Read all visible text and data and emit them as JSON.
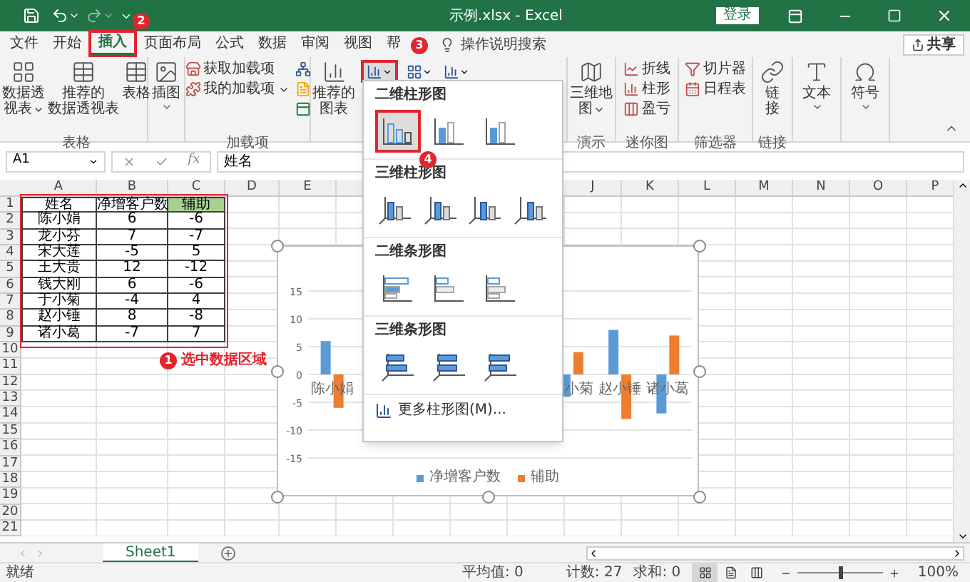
{
  "window": {
    "title": "示例.xlsx - Excel",
    "sign_in": "登录"
  },
  "tabs": [
    {
      "label": "文件",
      "selected": false,
      "highlighted": false
    },
    {
      "label": "开始",
      "selected": false,
      "highlighted": false
    },
    {
      "label": "插入",
      "selected": true,
      "highlighted": true
    },
    {
      "label": "页面布局",
      "selected": false,
      "highlighted": false
    },
    {
      "label": "公式",
      "selected": false,
      "highlighted": false
    },
    {
      "label": "数据",
      "selected": false,
      "highlighted": false
    },
    {
      "label": "审阅",
      "selected": false,
      "highlighted": false
    },
    {
      "label": "视图",
      "selected": false,
      "highlighted": false
    },
    {
      "label": "帮",
      "selected": false,
      "highlighted": false
    }
  ],
  "search": {
    "label": "操作说明搜索"
  },
  "share": {
    "label": "共享"
  },
  "ribbon": [
    {
      "name": "表格",
      "items": [
        {
          "kind": "large",
          "lines": [
            "数据透",
            "视表"
          ],
          "caret": true
        },
        {
          "kind": "large",
          "lines": [
            "推荐的",
            "数据透视表"
          ],
          "caret": false
        },
        {
          "kind": "large",
          "lines": [
            "表格"
          ],
          "caret": false
        }
      ]
    },
    {
      "items": [
        {
          "kind": "large",
          "lines": [
            "插图"
          ],
          "caret": true
        }
      ]
    },
    {
      "name": "加载项",
      "items": [
        {
          "kind": "small",
          "label": "获取加载项",
          "caret": false
        },
        {
          "kind": "small",
          "label": "我的加载项",
          "caret": true
        },
        {
          "kind": "icons"
        }
      ]
    },
    {
      "items": [
        {
          "kind": "large",
          "lines": [
            "推荐的",
            "图表"
          ],
          "caret": false
        },
        {
          "kind": "charts",
          "buttons": [
            {
              "highlighted": true
            },
            {
              "highlighted": false
            },
            {
              "highlighted": false
            }
          ]
        }
      ]
    },
    {
      "name": "演示",
      "items": [
        {
          "kind": "large",
          "lines": [
            "三维地",
            "图"
          ],
          "caret": true
        }
      ]
    },
    {
      "name": "迷你图",
      "items": [
        {
          "kind": "small",
          "label": "折线",
          "caret": false
        },
        {
          "kind": "small",
          "label": "柱形",
          "caret": false
        },
        {
          "kind": "small",
          "label": "盈亏",
          "caret": false
        }
      ]
    },
    {
      "name": "筛选器",
      "items": [
        {
          "kind": "small",
          "label": "切片器",
          "caret": false
        },
        {
          "kind": "small",
          "label": "日程表",
          "caret": false
        }
      ]
    },
    {
      "name": "链接",
      "items": [
        {
          "kind": "large",
          "lines": [
            "链",
            "接"
          ],
          "caret": false
        }
      ]
    },
    {
      "items": [
        {
          "kind": "large",
          "lines": [
            "文本"
          ],
          "caret": true
        }
      ]
    },
    {
      "items": [
        {
          "kind": "large",
          "lines": [
            "符号"
          ],
          "caret": true
        }
      ]
    }
  ],
  "formula_bar": {
    "name_box": "A1",
    "function_label": "fx",
    "value": "姓名"
  },
  "grid": {
    "columns": [
      "A",
      "B",
      "C",
      "D",
      "E",
      "J",
      "K",
      "L",
      "M",
      "N",
      "O",
      "P"
    ],
    "row_numbers": [
      "1",
      "2",
      "3",
      "4",
      "5",
      "6",
      "7",
      "8",
      "9",
      "10",
      "11",
      "12",
      "13",
      "14",
      "15",
      "16",
      "17",
      "18",
      "19",
      "20",
      "21"
    ],
    "header": [
      {
        "text": "姓名",
        "highlighted": false
      },
      {
        "text": "净增客户数",
        "highlighted": false
      },
      {
        "text": "辅助",
        "highlighted": true
      }
    ],
    "rows": [
      [
        "陈小娟",
        "6",
        "-6"
      ],
      [
        "龙小芬",
        "7",
        "-7"
      ],
      [
        "宋大莲",
        "-5",
        "5"
      ],
      [
        "王大贵",
        "12",
        "-12"
      ],
      [
        "钱大刚",
        "6",
        "-6"
      ],
      [
        "于小菊",
        "-4",
        "4"
      ],
      [
        "赵小锤",
        "8",
        "-8"
      ],
      [
        "诸小葛",
        "-7",
        "7"
      ]
    ]
  },
  "chart": {
    "chart_data": {
      "type": "bar",
      "categories": [
        "陈小娟",
        null,
        null,
        null,
        null,
        "小菊",
        "赵小锤",
        "诸小葛"
      ],
      "series": [
        {
          "name": "净增客户数",
          "color": "#5b9bd5",
          "values": [
            6,
            null,
            null,
            null,
            null,
            -4,
            8,
            -7
          ]
        },
        {
          "name": "辅助",
          "color": "#ed7d31",
          "values": [
            -6,
            null,
            null,
            null,
            null,
            4,
            -8,
            7
          ]
        }
      ],
      "ylim": [
        -15,
        15
      ],
      "yticks": [
        -15,
        -10,
        -5,
        0,
        5,
        10,
        15
      ],
      "grid": true
    }
  },
  "chart_menu": {
    "sections": [
      {
        "title": "二维柱形图",
        "kind": "column",
        "options": [
          {
            "selected": true
          },
          {
            "selected": false
          },
          {
            "selected": false
          }
        ]
      },
      {
        "title": "三维柱形图",
        "kind": "column3d",
        "options": [
          {
            "selected": false
          },
          {
            "selected": false
          },
          {
            "selected": false
          },
          {
            "selected": false
          }
        ]
      },
      {
        "title": "二维条形图",
        "kind": "bar",
        "options": [
          {
            "selected": false
          },
          {
            "selected": false
          },
          {
            "selected": false
          }
        ]
      },
      {
        "title": "三维条形图",
        "kind": "bar3d",
        "options": [
          {
            "selected": false
          },
          {
            "selected": false
          },
          {
            "selected": false
          }
        ]
      }
    ],
    "more": "更多柱形图(M)..."
  },
  "annotations": [
    {
      "number": "1",
      "label": "选中数据区域"
    },
    {
      "number": "2"
    },
    {
      "number": "3"
    },
    {
      "number": "4"
    }
  ],
  "sheet_tabs": [
    {
      "label": "Sheet1",
      "selected": true
    }
  ],
  "status_bar": {
    "status": "就绪",
    "average": "平均值: 0",
    "count": "计数: 27",
    "sum": "求和: 0",
    "views": [
      {
        "selected": true
      },
      {
        "selected": false
      },
      {
        "selected": false
      }
    ],
    "zoom": {
      "level": 0.5,
      "label": "100%"
    }
  }
}
